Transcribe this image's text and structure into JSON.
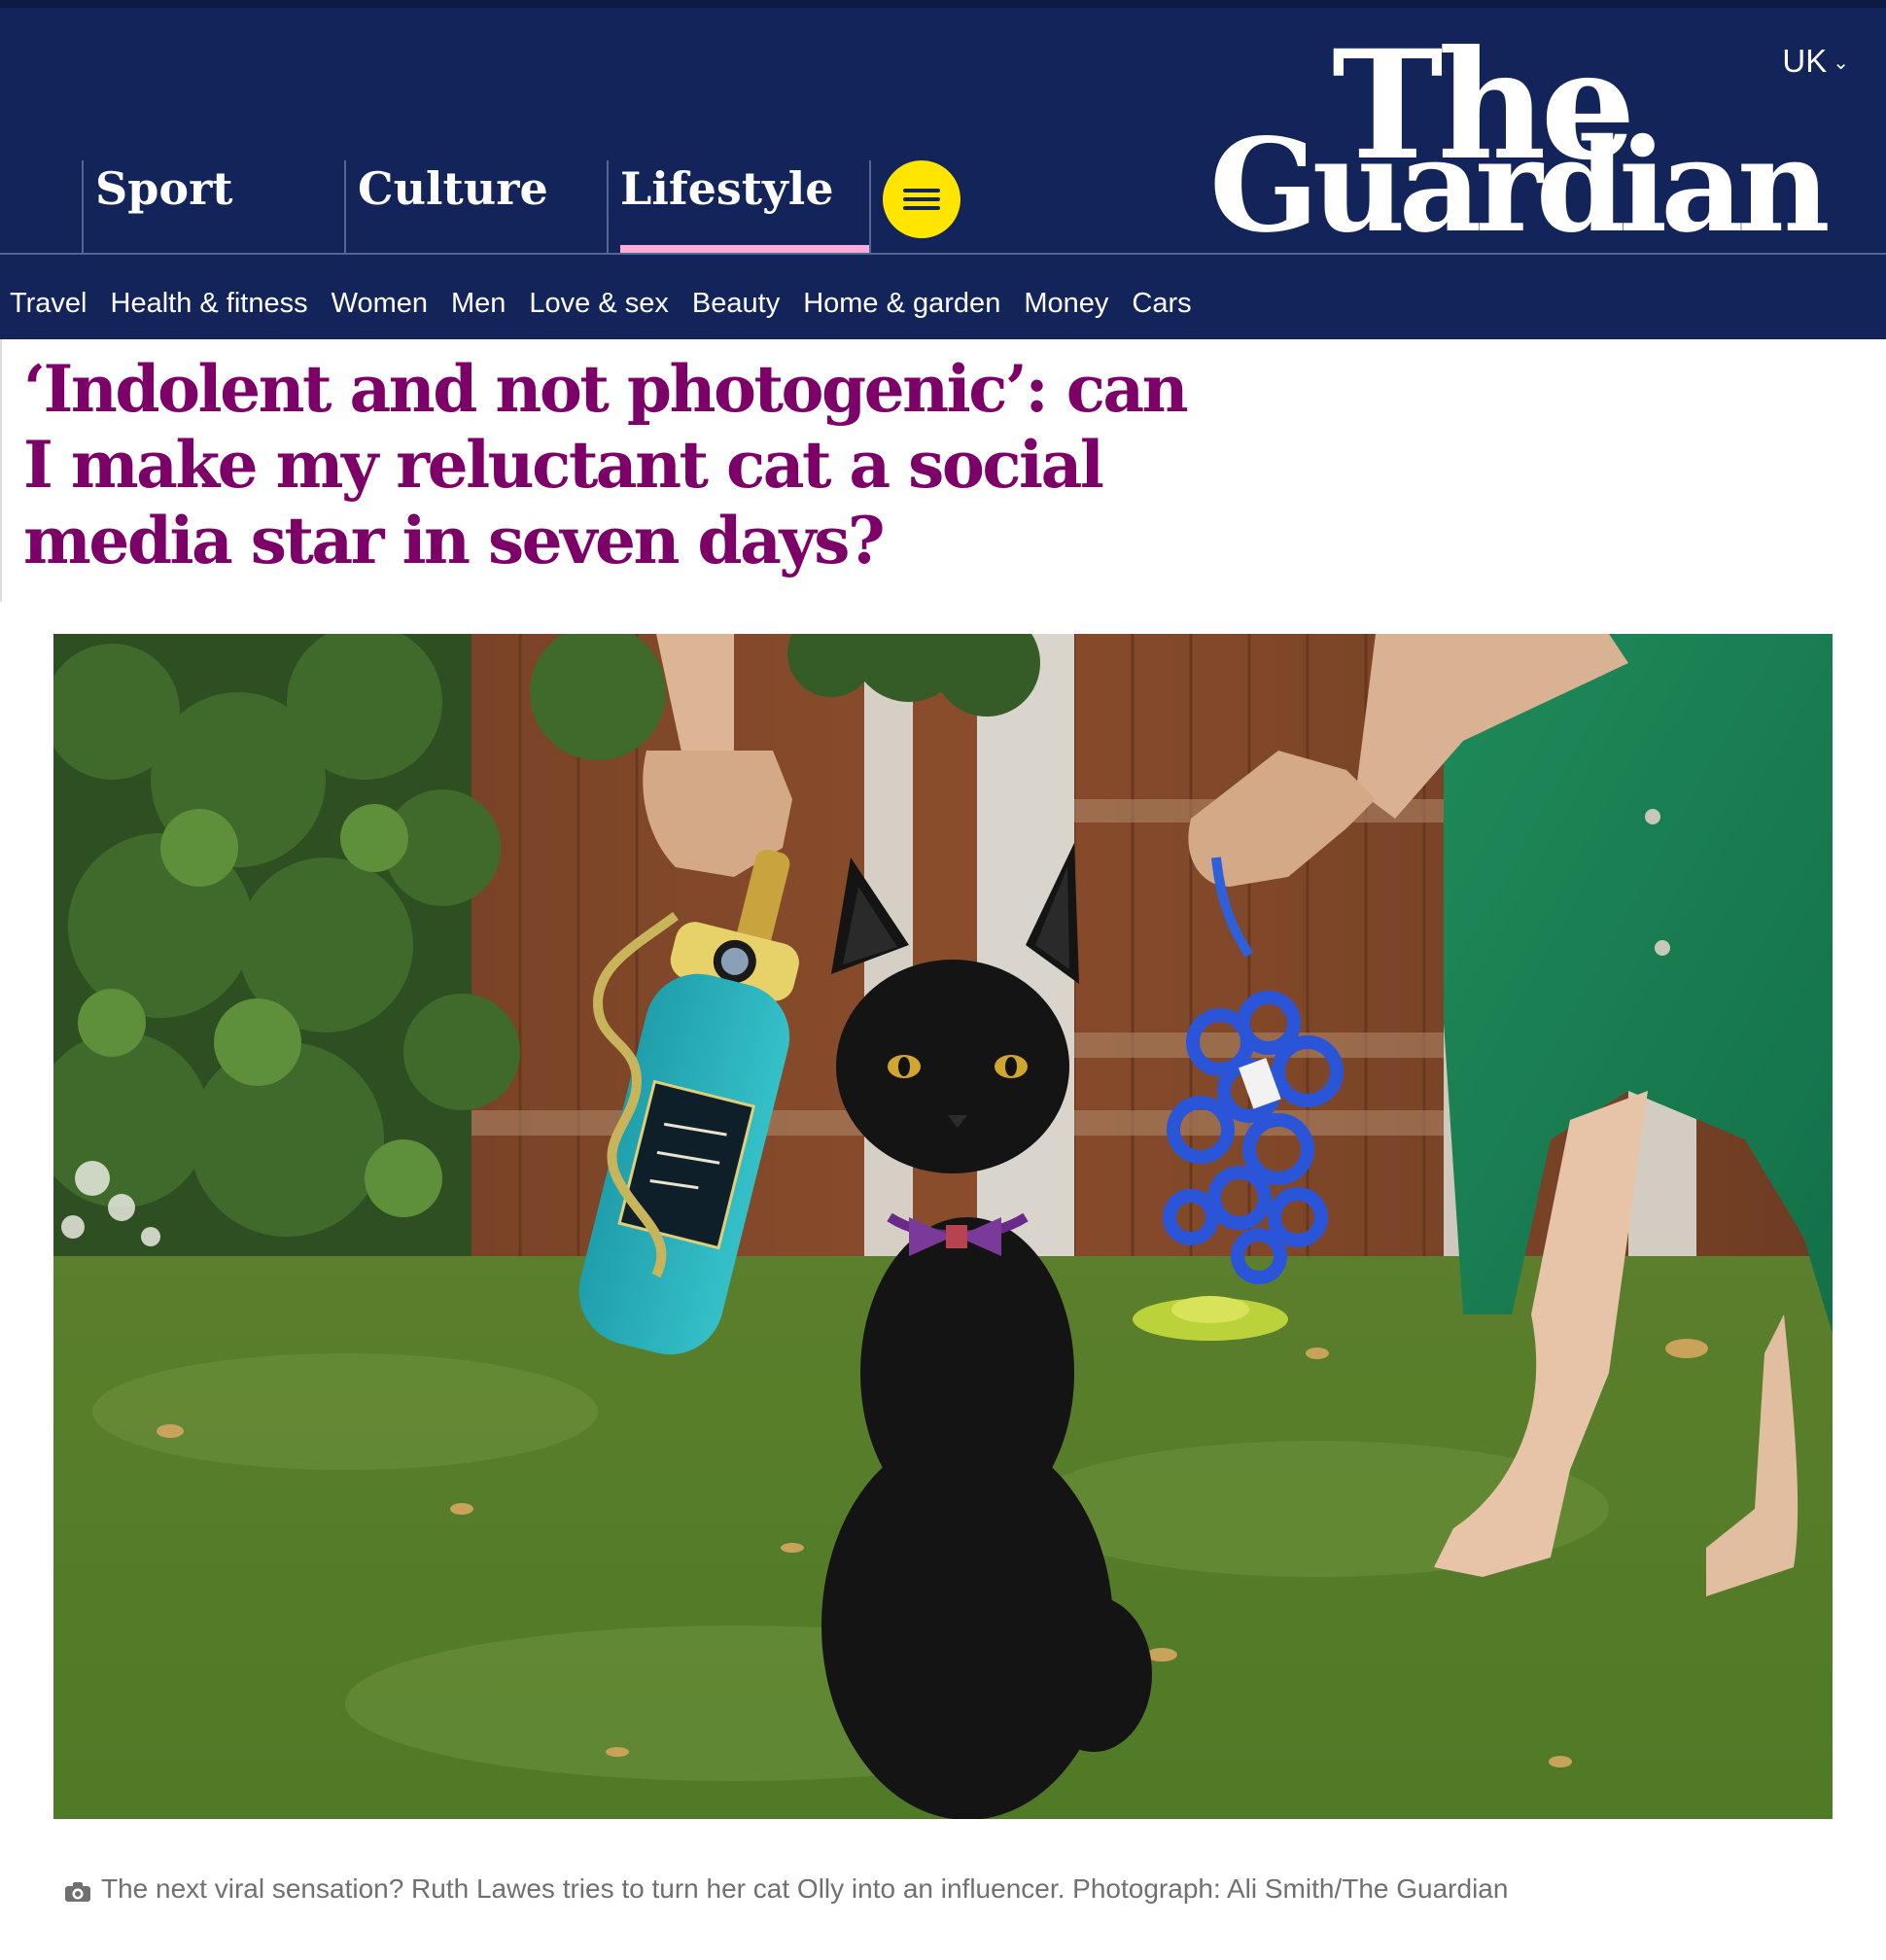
{
  "header": {
    "region": "UK",
    "logo": {
      "line1": "The",
      "line2": "Guardian"
    },
    "pillars": [
      {
        "label": "Sport",
        "active": false
      },
      {
        "label": "Culture",
        "active": false
      },
      {
        "label": "Lifestyle",
        "active": true
      }
    ],
    "menu_icon": "hamburger-icon",
    "subnav": [
      "Travel",
      "Health & fitness",
      "Women",
      "Men",
      "Love & sex",
      "Beauty",
      "Home & garden",
      "Money",
      "Cars"
    ]
  },
  "article": {
    "headline": "‘Indolent and not photogenic’: can I make my reluctant cat a social media star in seven days?",
    "caption": "The next viral sensation? Ruth Lawes tries to turn her cat Olly into an influencer. Photograph: Ali Smith/The Guardian",
    "caption_icon": "camera-icon"
  },
  "colors": {
    "masthead": "#13245a",
    "headline": "#7d0068",
    "menu_pill": "#ffe500",
    "active_underline": "#ffabdb"
  }
}
